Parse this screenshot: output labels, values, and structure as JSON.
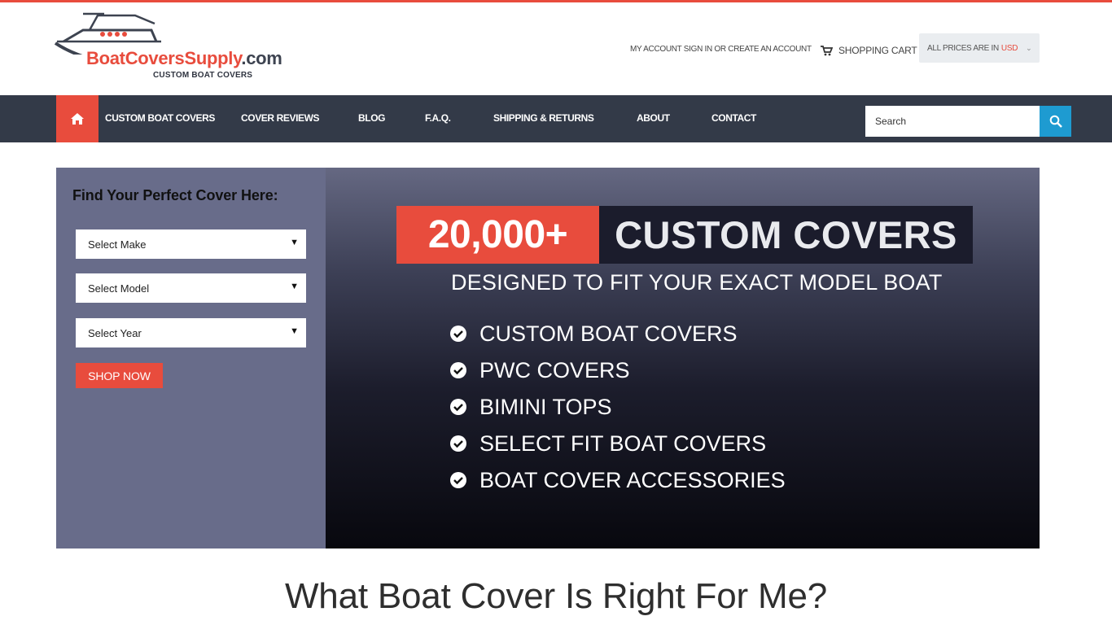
{
  "header": {
    "logo": {
      "name_red": "BoatCoversSupply",
      "name_dark": ".com",
      "tagline": "CUSTOM BOAT COVERS"
    },
    "account_links": "MY ACCOUNT SIGN IN OR CREATE AN ACCOUNT",
    "cart_label": "SHOPPING CART",
    "currency": {
      "prefix": "ALL PRICES ARE IN",
      "code": "USD"
    }
  },
  "nav": {
    "items": [
      "CUSTOM BOAT COVERS",
      "COVER REVIEWS",
      "BLOG",
      "F.A.Q.",
      "SHIPPING & RETURNS",
      "ABOUT",
      "CONTACT"
    ],
    "search_placeholder": "Search"
  },
  "finder": {
    "title": "Find Your Perfect Cover Here:",
    "selects": [
      "Select Make",
      "Select Model",
      "Select Year"
    ],
    "button": "SHOP NOW"
  },
  "banner": {
    "number": "20,000+",
    "heading": "CUSTOM COVERS",
    "subheading": "DESIGNED TO FIT YOUR EXACT MODEL BOAT",
    "list": [
      "CUSTOM BOAT COVERS",
      "PWC COVERS",
      "BIMINI TOPS",
      "SELECT FIT BOAT COVERS",
      "BOAT COVER ACCESSORIES"
    ]
  },
  "headline": "What Boat Cover Is Right For Me?",
  "colors": {
    "accent": "#e84c3d",
    "nav_bg": "#333a48",
    "search_btn": "#1e9bd1",
    "finder_bg": "#686c8a"
  }
}
